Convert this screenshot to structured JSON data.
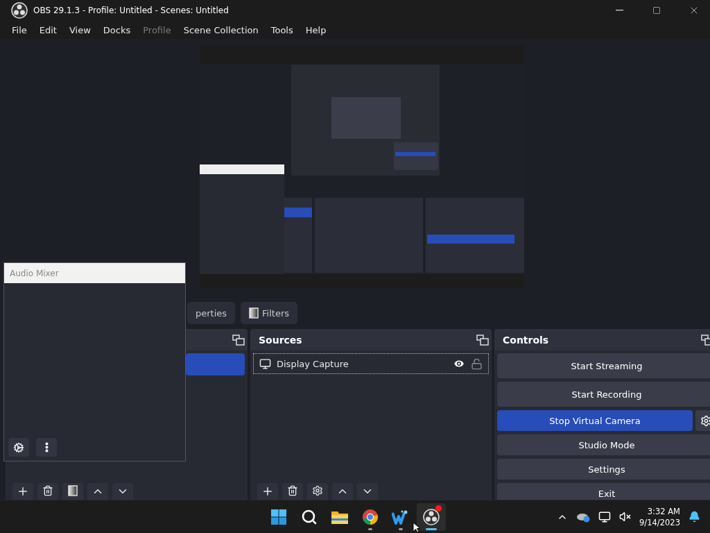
{
  "window": {
    "title": "OBS 29.1.3 - Profile: Untitled - Scenes: Untitled"
  },
  "menu": [
    {
      "label": "File",
      "disabled": false
    },
    {
      "label": "Edit",
      "disabled": false
    },
    {
      "label": "View",
      "disabled": false
    },
    {
      "label": "Docks",
      "disabled": false
    },
    {
      "label": "Profile",
      "disabled": true
    },
    {
      "label": "Scene Collection",
      "disabled": false
    },
    {
      "label": "Tools",
      "disabled": false
    },
    {
      "label": "Help",
      "disabled": false
    }
  ],
  "context_bar": {
    "buttons": [
      {
        "label": "perties",
        "kind": "properties"
      },
      {
        "label": "Filters",
        "kind": "filters"
      }
    ]
  },
  "scenes": {
    "items": [
      {
        "selected": true
      }
    ]
  },
  "sources": {
    "title": "Sources",
    "items": [
      {
        "label": "Display Capture",
        "visible": true,
        "locked": false
      }
    ]
  },
  "controls": {
    "title": "Controls",
    "buttons": [
      {
        "label": "Start Streaming",
        "active": false,
        "kind": "plain"
      },
      {
        "label": "Start Recording",
        "active": false,
        "kind": "plain"
      },
      {
        "label": "Stop Virtual Camera",
        "active": true,
        "kind": "split"
      },
      {
        "label": "Studio Mode",
        "active": false,
        "kind": "plain"
      },
      {
        "label": "Settings",
        "active": false,
        "kind": "plain"
      },
      {
        "label": "Exit",
        "active": false,
        "kind": "plain"
      }
    ]
  },
  "audio_mixer": {
    "title": "Audio Mixer"
  },
  "taskbar": {
    "apps": [
      {
        "kind": "start",
        "running": false,
        "active": false,
        "badge": false
      },
      {
        "kind": "search",
        "running": false,
        "active": false,
        "badge": false
      },
      {
        "kind": "files",
        "running": false,
        "active": false,
        "badge": false
      },
      {
        "kind": "browser",
        "running": true,
        "active": false,
        "badge": false
      },
      {
        "kind": "writer",
        "running": true,
        "active": false,
        "badge": false
      },
      {
        "kind": "obs",
        "running": true,
        "active": true,
        "badge": true
      }
    ],
    "time": "3:32 AM",
    "date": "9/14/2023"
  }
}
